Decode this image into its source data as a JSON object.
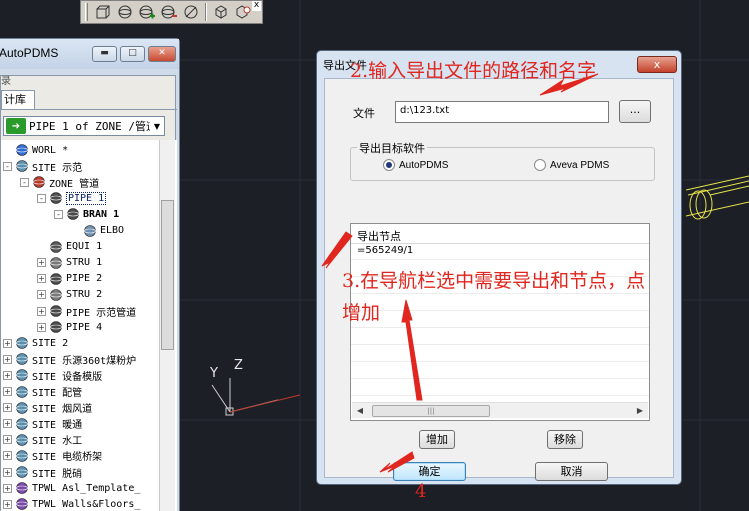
{
  "toolbar": {
    "icons": [
      "box-icon",
      "sphere-icon",
      "sphere-add-icon",
      "sphere-subtract-icon",
      "slash-circle-icon",
      "cube-icon",
      "cube-subtract-icon"
    ],
    "close_label": "x"
  },
  "left_panel": {
    "title": "AutoPDMS",
    "subtitle": "录",
    "tab_label": "计库",
    "combo_value": "PIPE 1 of ZONE /管道",
    "tree": [
      {
        "label": "WORL *",
        "level": 0,
        "expander": "",
        "icon": "world-icon"
      },
      {
        "label": "SITE 示范",
        "level": 0,
        "expander": "-",
        "icon": "site-icon"
      },
      {
        "label": "ZONE 管道",
        "level": 1,
        "expander": "-",
        "icon": "zone-icon"
      },
      {
        "label": "PIPE 1",
        "level": 2,
        "expander": "-",
        "icon": "pipe-icon",
        "selected": true
      },
      {
        "label": "BRAN 1",
        "level": 3,
        "expander": "-",
        "icon": "branch-icon",
        "bold": true
      },
      {
        "label": "ELBO",
        "level": 4,
        "expander": "",
        "icon": "elbow-icon"
      },
      {
        "label": "EQUI 1",
        "level": 2,
        "expander": "",
        "icon": "equipment-icon"
      },
      {
        "label": "STRU 1",
        "level": 2,
        "expander": "+",
        "icon": "structure-icon"
      },
      {
        "label": "PIPE 2",
        "level": 2,
        "expander": "+",
        "icon": "pipe-icon"
      },
      {
        "label": "STRU 2",
        "level": 2,
        "expander": "+",
        "icon": "structure-icon"
      },
      {
        "label": "PIPE 示范管道",
        "level": 2,
        "expander": "+",
        "icon": "pipe-icon"
      },
      {
        "label": "PIPE 4",
        "level": 2,
        "expander": "+",
        "icon": "pipe-icon"
      },
      {
        "label": "SITE 2",
        "level": 0,
        "expander": "+",
        "icon": "site-icon"
      },
      {
        "label": "SITE 乐源360t煤粉炉",
        "level": 0,
        "expander": "+",
        "icon": "site-icon"
      },
      {
        "label": "SITE 设备模版",
        "level": 0,
        "expander": "+",
        "icon": "site-icon"
      },
      {
        "label": "SITE 配管",
        "level": 0,
        "expander": "+",
        "icon": "site-icon"
      },
      {
        "label": "SITE 烟风道",
        "level": 0,
        "expander": "+",
        "icon": "site-icon"
      },
      {
        "label": "SITE 暖通",
        "level": 0,
        "expander": "+",
        "icon": "site-icon"
      },
      {
        "label": "SITE 水工",
        "level": 0,
        "expander": "+",
        "icon": "site-icon"
      },
      {
        "label": "SITE 电缆桥架",
        "level": 0,
        "expander": "+",
        "icon": "site-icon"
      },
      {
        "label": "SITE 脱硝",
        "level": 0,
        "expander": "+",
        "icon": "site-icon"
      },
      {
        "label": "TPWL Asl_Template_",
        "level": 0,
        "expander": "+",
        "icon": "template-icon"
      },
      {
        "label": "TPWL Walls&Floors_",
        "level": 0,
        "expander": "+",
        "icon": "template-icon"
      }
    ]
  },
  "axis": {
    "y": "Y",
    "z": "Z"
  },
  "dialog": {
    "title": "导出文件",
    "close_label": "x",
    "file_label": "文件",
    "file_value": "d:\\123.txt",
    "browse_label": "...",
    "target_group_title": "导出目标软件",
    "options": [
      {
        "label": "AutoPDMS",
        "checked": true
      },
      {
        "label": "Aveva PDMS",
        "checked": false
      }
    ],
    "nodes_header": "导出节点",
    "nodes": [
      "=565249/1"
    ],
    "add_label": "增加",
    "remove_label": "移除",
    "ok_label": "确定",
    "cancel_label": "取消"
  },
  "annotations": {
    "step2": "2.输入导出文件的路径和名字",
    "step3_line1": "3.在导航栏选中需要导出和节点，点",
    "step3_line2": "增加",
    "step4": "4",
    "color": "#e0261e"
  }
}
